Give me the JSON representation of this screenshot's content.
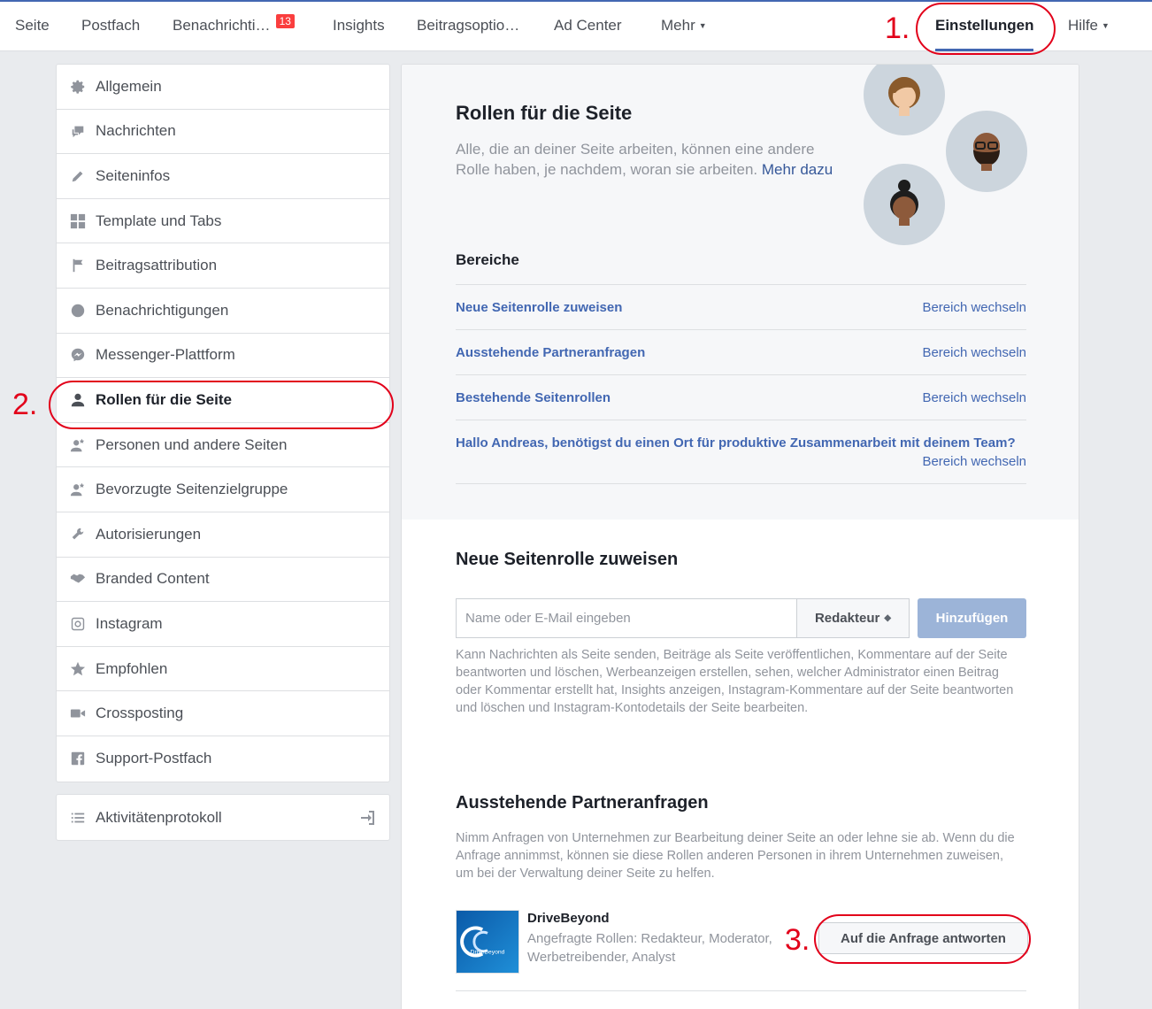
{
  "topnav": {
    "items": [
      {
        "label": "Seite"
      },
      {
        "label": "Postfach"
      },
      {
        "label": "Benachrichti…",
        "badge": "13"
      },
      {
        "label": "Insights"
      },
      {
        "label": "Beitragsoptio…"
      },
      {
        "label": "Ad Center"
      },
      {
        "label": "Mehr"
      },
      {
        "label": "Einstellungen"
      },
      {
        "label": "Hilfe"
      }
    ]
  },
  "annotations": {
    "one": "1.",
    "two": "2.",
    "three": "3."
  },
  "sidebar": {
    "items": [
      {
        "label": "Allgemein",
        "icon": "gear-icon"
      },
      {
        "label": "Nachrichten",
        "icon": "chat-bubbles-icon"
      },
      {
        "label": "Seiteninfos",
        "icon": "pencil-icon"
      },
      {
        "label": "Template und Tabs",
        "icon": "grid-icon"
      },
      {
        "label": "Beitragsattribution",
        "icon": "flag-icon"
      },
      {
        "label": "Benachrichtigungen",
        "icon": "globe-icon"
      },
      {
        "label": "Messenger-Plattform",
        "icon": "messenger-icon"
      },
      {
        "label": "Rollen für die Seite",
        "icon": "person-icon"
      },
      {
        "label": "Personen und andere Seiten",
        "icon": "person-star-icon"
      },
      {
        "label": "Bevorzugte Seitenzielgruppe",
        "icon": "person-star-icon"
      },
      {
        "label": "Autorisierungen",
        "icon": "wrench-icon"
      },
      {
        "label": "Branded Content",
        "icon": "handshake-icon"
      },
      {
        "label": "Instagram",
        "icon": "instagram-icon"
      },
      {
        "label": "Empfohlen",
        "icon": "star-icon"
      },
      {
        "label": "Crossposting",
        "icon": "video-camera-icon"
      },
      {
        "label": "Support-Postfach",
        "icon": "facebook-icon"
      }
    ],
    "activity": {
      "label": "Aktivitätenprotokoll",
      "icon": "list-icon"
    }
  },
  "hero": {
    "title": "Rollen für die Seite",
    "description": "Alle, die an deiner Seite arbeiten, können eine andere Rolle haben, je nachdem, woran sie arbeiten.",
    "more_link": "Mehr dazu",
    "sections_title": "Bereiche",
    "sections": [
      {
        "label": "Neue Seitenrolle zuweisen",
        "action": "Bereich wechseln"
      },
      {
        "label": "Ausstehende Partneranfragen",
        "action": "Bereich wechseln"
      },
      {
        "label": "Bestehende Seitenrollen",
        "action": "Bereich wechseln"
      },
      {
        "label": "Hallo Andreas, benötigst du einen Ort für produktive Zusammenarbeit mit deinem Team?",
        "action": "Bereich wechseln"
      }
    ]
  },
  "assign": {
    "title": "Neue Seitenrolle zuweisen",
    "input_placeholder": "Name oder E-Mail eingeben",
    "role_selected": "Redakteur",
    "add_button": "Hinzufügen",
    "help": "Kann Nachrichten als Seite senden, Beiträge als Seite veröffentlichen, Kommentare auf der Seite beantworten und löschen, Werbeanzeigen erstellen, sehen, welcher Administrator einen Beitrag oder Kommentar erstellt hat, Insights anzeigen, Instagram-Kommentare auf der Seite beantworten und löschen und Instagram-Kontodetails der Seite bearbeiten."
  },
  "partner": {
    "title": "Ausstehende Partneranfragen",
    "help": "Nimm Anfragen von Unternehmen zur Bearbeitung deiner Seite an oder lehne sie ab. Wenn du die Anfrage annimmst, können sie diese Rollen anderen Personen in ihrem Unternehmen zuweisen, um bei der Verwaltung deiner Seite zu helfen.",
    "request": {
      "name": "DriveBeyond",
      "logo_text": "DriveBeyond",
      "roles": "Angefragte Rollen: Redakteur, Moderator, Werbetreibender, Analyst",
      "respond_button": "Auf die Anfrage antworten"
    }
  }
}
